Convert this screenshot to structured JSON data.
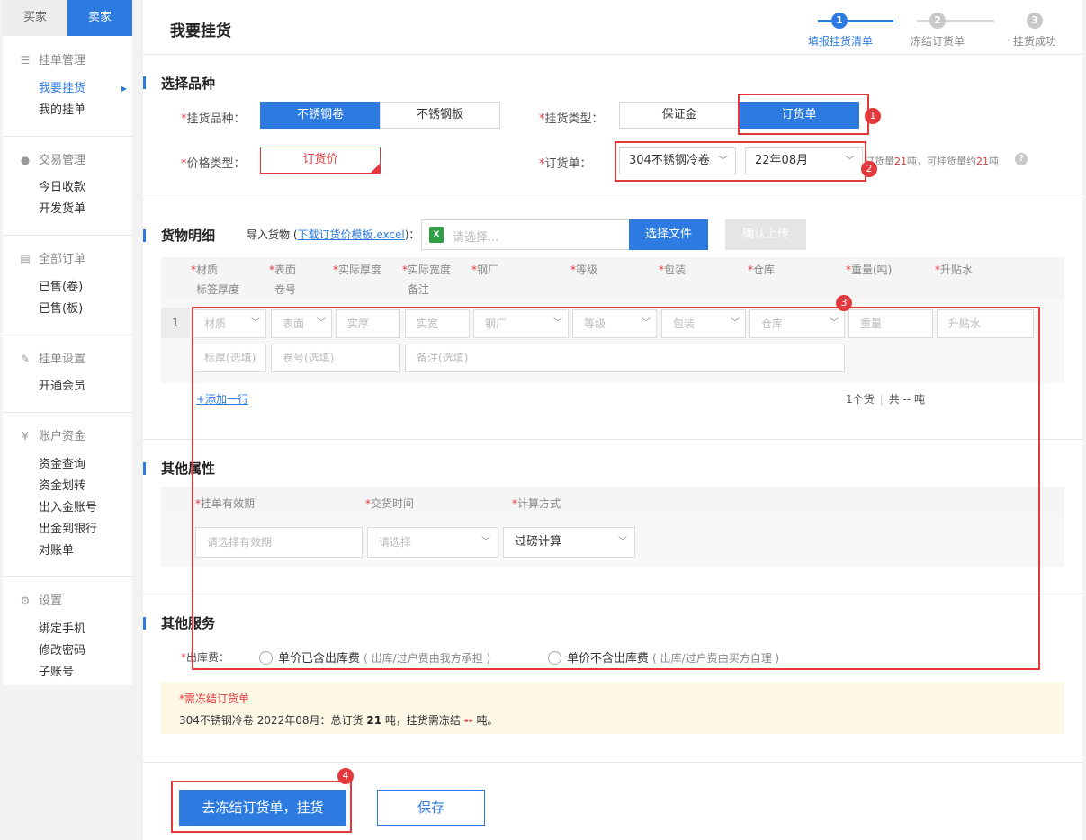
{
  "sidebar": {
    "role_tabs": {
      "buyer": "买家",
      "seller": "卖家"
    },
    "groups": [
      {
        "title": "挂单管理",
        "icon": "list-icon",
        "items": [
          "我要挂货",
          "我的挂单"
        ]
      },
      {
        "title": "交易管理",
        "icon": "trade-icon",
        "items": [
          "今日收款",
          "开发货单"
        ]
      },
      {
        "title": "全部订单",
        "icon": "orders-icon",
        "items": [
          "已售(卷)",
          "已售(板)"
        ]
      },
      {
        "title": "挂单设置",
        "icon": "edit-icon",
        "items": [
          "开通会员"
        ]
      },
      {
        "title": "账户资金",
        "icon": "yen-icon",
        "items": [
          "资金查询",
          "资金划转",
          "出入金账号",
          "出金到银行",
          "对账单"
        ]
      },
      {
        "title": "设置",
        "icon": "gear-icon",
        "items": [
          "绑定手机",
          "修改密码",
          "子账号"
        ]
      }
    ],
    "active_item": "我要挂货"
  },
  "page": {
    "title": "我要挂货",
    "steps": [
      {
        "num": "1",
        "label": "填报挂货清单"
      },
      {
        "num": "2",
        "label": "冻结订货单"
      },
      {
        "num": "3",
        "label": "挂货成功"
      }
    ]
  },
  "select_variety": {
    "title": "选择品种",
    "variety_label": "挂货品种：",
    "variety_options": [
      "不锈钢卷",
      "不锈钢板"
    ],
    "type_label": "挂货类型：",
    "type_options": [
      "保证金",
      "订货单"
    ],
    "price_label": "价格类型：",
    "price_value": "订货价",
    "order_label": "订货单：",
    "order_product": "304不锈钢冷卷",
    "order_month": "22年08月",
    "order_info_prefix": "订货量",
    "order_qty": "21",
    "order_info_mid": "吨，可挂货量约",
    "order_avail": "21",
    "order_info_suffix": "吨",
    "help": "?"
  },
  "goods": {
    "title": "货物明细",
    "import_label": "导入货物 (",
    "template_link": "下载订货价模板.excel",
    "import_label_end": ")：",
    "file_placeholder": "请选择...",
    "choose_file": "选择文件",
    "confirm_upload": "确认上传",
    "columns": {
      "material": "材质",
      "surface": "表面",
      "thickness": "实际厚度",
      "width": "实际宽度",
      "mill": "钢厂",
      "grade": "等级",
      "package": "包装",
      "warehouse": "仓库",
      "weight": "重量(吨)",
      "subsidy": "升贴水",
      "label_thickness": "标签厚度",
      "coil_no": "卷号",
      "remark": "备注"
    },
    "row": {
      "num": "1",
      "material": "材质",
      "surface": "表面",
      "thickness": "实厚",
      "width": "实宽",
      "mill": "钢厂",
      "grade": "等级",
      "package": "包装",
      "warehouse": "仓库",
      "weight": "重量",
      "subsidy": "升贴水",
      "label_thickness": "标厚(选填)",
      "coil_no": "卷号(选填)",
      "remark": "备注(选填)"
    },
    "add_row": "+添加一行",
    "count": "1个货",
    "total": "共 -- 吨"
  },
  "attributes": {
    "title": "其他属性",
    "validity_label": "挂单有效期",
    "delivery_label": "交货时间",
    "calc_label": "计算方式",
    "validity_placeholder": "请选择有效期",
    "delivery_placeholder": "请选择",
    "calc_value": "过磅计算"
  },
  "services": {
    "title": "其他服务",
    "fee_label": "出库费：",
    "option1": "单价已含出库费",
    "option1_hint": "( 出库/过户费由我方承担 )",
    "option2": "单价不含出库费",
    "option2_hint": "( 出库/过户费由买方自理 )"
  },
  "notice": {
    "title": "需冻结订货单",
    "text_a": "304不锈钢冷卷 2022年08月：总订货 ",
    "qty": "21",
    "text_b": " 吨，挂货需冻结 ",
    "freeze": "--",
    "text_c": " 吨。"
  },
  "actions": {
    "submit": "去冻结订货单，挂货",
    "save": "保存"
  },
  "annotations": [
    "1",
    "2",
    "3",
    "4"
  ],
  "colors": {
    "accent": "#2d7be0",
    "required": "#e4393c",
    "annotation": "#e4393c",
    "notice_bg": "#fdf8e6"
  }
}
